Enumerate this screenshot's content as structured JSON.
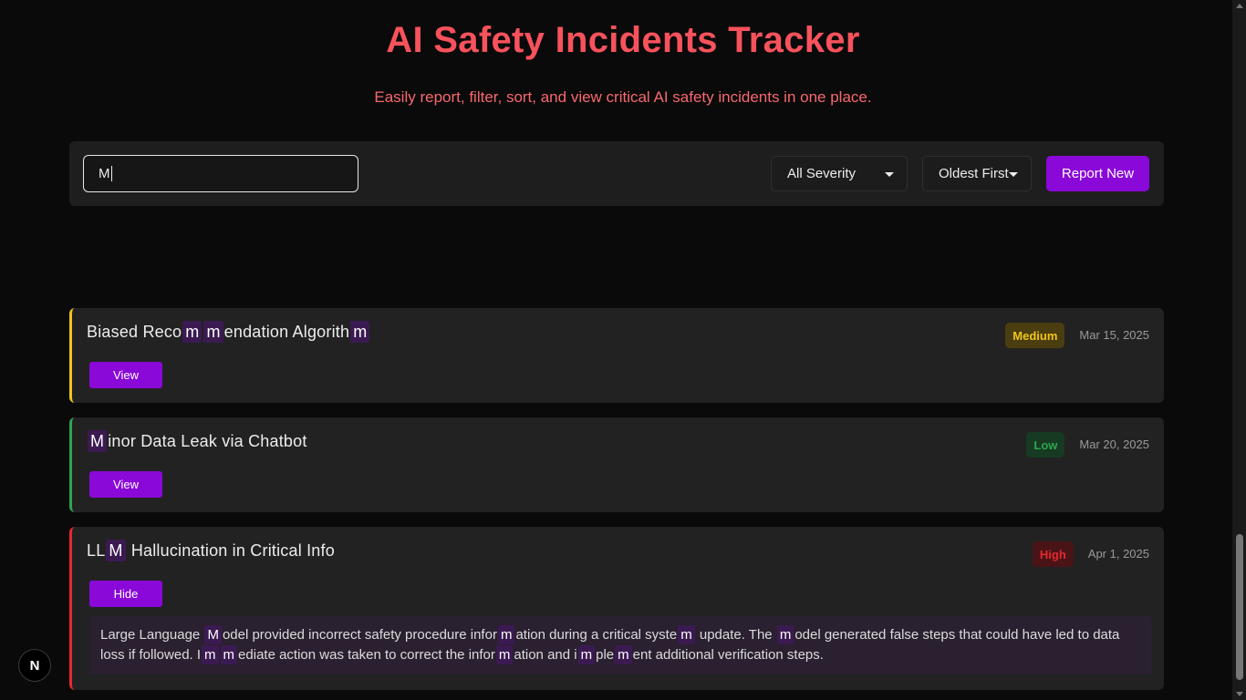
{
  "header": {
    "title": "AI Safety Incidents Tracker",
    "subtitle": "Easily report, filter, sort, and view critical AI safety incidents in one place."
  },
  "toolbar": {
    "search_value": "M",
    "severity_selected": "All Severity",
    "sort_selected": "Oldest First",
    "report_label": "Report New"
  },
  "highlight_color": "#3b1a52",
  "incidents": [
    {
      "title_parts": [
        {
          "t": "Biased Reco",
          "h": false
        },
        {
          "t": "m",
          "h": true
        },
        {
          "t": "m",
          "h": true
        },
        {
          "t": "endation Algorith",
          "h": false
        },
        {
          "t": "m",
          "h": true
        }
      ],
      "severity": "Medium",
      "severity_color": "#f0c419",
      "date": "Mar 15, 2025",
      "button_label": "View",
      "expanded": false
    },
    {
      "title_parts": [
        {
          "t": "M",
          "h": true
        },
        {
          "t": "inor Data Leak via Chatbot",
          "h": false
        }
      ],
      "severity": "Low",
      "severity_color": "#2ea44f",
      "date": "Mar 20, 2025",
      "button_label": "View",
      "expanded": false
    },
    {
      "title_parts": [
        {
          "t": "LL",
          "h": false
        },
        {
          "t": "M",
          "h": true
        },
        {
          "t": " Hallucination in Critical Info",
          "h": false
        }
      ],
      "severity": "High",
      "severity_color": "#e5292f",
      "date": "Apr 1, 2025",
      "button_label": "Hide",
      "expanded": true,
      "description_parts": [
        {
          "t": "Large Language ",
          "h": false
        },
        {
          "t": "M",
          "h": true
        },
        {
          "t": "odel provided incorrect safety procedure infor",
          "h": false
        },
        {
          "t": "m",
          "h": true
        },
        {
          "t": "ation during a critical syste",
          "h": false
        },
        {
          "t": "m",
          "h": true
        },
        {
          "t": " update. The ",
          "h": false
        },
        {
          "t": "m",
          "h": true
        },
        {
          "t": "odel generated false steps that could have led to data loss if followed. I",
          "h": false
        },
        {
          "t": "m",
          "h": true
        },
        {
          "t": "m",
          "h": true
        },
        {
          "t": "ediate action was taken to correct the infor",
          "h": false
        },
        {
          "t": "m",
          "h": true
        },
        {
          "t": "ation and i",
          "h": false
        },
        {
          "t": "m",
          "h": true
        },
        {
          "t": "ple",
          "h": false
        },
        {
          "t": "m",
          "h": true
        },
        {
          "t": "ent additional verification steps.",
          "h": false
        }
      ]
    }
  ],
  "dev_badge": "N"
}
